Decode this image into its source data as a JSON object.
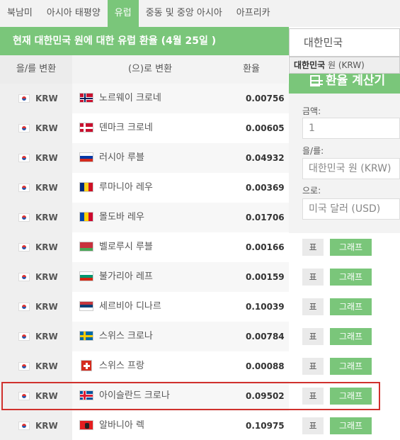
{
  "tabs": [
    {
      "label": "북남미"
    },
    {
      "label": "아시아 태평양"
    },
    {
      "label": "유럽"
    },
    {
      "label": "중동 및 중앙 아시아"
    },
    {
      "label": "아프리카"
    }
  ],
  "header": {
    "title": "현재 대한민국 원에 대한 유럽 환율 (4월 25일 )"
  },
  "columns": {
    "from": "을/를 변환",
    "to": "(으)로 변환",
    "rate": "환율"
  },
  "rows": [
    {
      "from_code": "KRW",
      "to_name": "노르웨이 크로네",
      "rate": "0.00756",
      "flag_icon": "norway-flag-icon"
    },
    {
      "from_code": "KRW",
      "to_name": "덴마크 크로네",
      "rate": "0.00605",
      "flag_icon": "denmark-flag-icon"
    },
    {
      "from_code": "KRW",
      "to_name": "러시아 루블",
      "rate": "0.04932",
      "flag_icon": "russia-flag-icon"
    },
    {
      "from_code": "KRW",
      "to_name": "루마니아 레우",
      "rate": "0.00369",
      "flag_icon": "romania-flag-icon"
    },
    {
      "from_code": "KRW",
      "to_name": "몰도바 레우",
      "rate": "0.01706",
      "flag_icon": "moldova-flag-icon"
    },
    {
      "from_code": "KRW",
      "to_name": "벨로루시 루블",
      "rate": "0.00166",
      "flag_icon": "belarus-flag-icon",
      "table_label": "표",
      "graph_label": "그래프"
    },
    {
      "from_code": "KRW",
      "to_name": "불가리아 레프",
      "rate": "0.00159",
      "flag_icon": "bulgaria-flag-icon",
      "table_label": "표",
      "graph_label": "그래프"
    },
    {
      "from_code": "KRW",
      "to_name": "세르비아 디나르",
      "rate": "0.10039",
      "flag_icon": "serbia-flag-icon",
      "table_label": "표",
      "graph_label": "그래프"
    },
    {
      "from_code": "KRW",
      "to_name": "스위스 크로나",
      "rate": "0.00784",
      "flag_icon": "sweden-flag-icon",
      "table_label": "표",
      "graph_label": "그래프"
    },
    {
      "from_code": "KRW",
      "to_name": "스위스 프랑",
      "rate": "0.00088",
      "flag_icon": "switzerland-flag-icon",
      "table_label": "표",
      "graph_label": "그래프"
    },
    {
      "from_code": "KRW",
      "to_name": "아이슬란드 크로나",
      "rate": "0.09502",
      "flag_icon": "iceland-flag-icon",
      "table_label": "표",
      "graph_label": "그래프",
      "highlighted": true
    },
    {
      "from_code": "KRW",
      "to_name": "알바니아 렉",
      "rate": "0.10975",
      "flag_icon": "albania-flag-icon",
      "table_label": "표",
      "graph_label": "그래프"
    }
  ],
  "country_search": {
    "value": "대한민국"
  },
  "dropdown": {
    "bold": "대한민국",
    "rest": " 원 (KRW)"
  },
  "calculator": {
    "title": "환율 계산기",
    "amount_label": "금액:",
    "amount_value": "1",
    "from_label": "을/를:",
    "from_value": "대한민국 원 (KRW)",
    "to_label": "으로:",
    "to_value": "미국 달러 (USD)"
  },
  "colors": {
    "accent": "#7ac67a",
    "highlight_border": "#d0312d"
  }
}
